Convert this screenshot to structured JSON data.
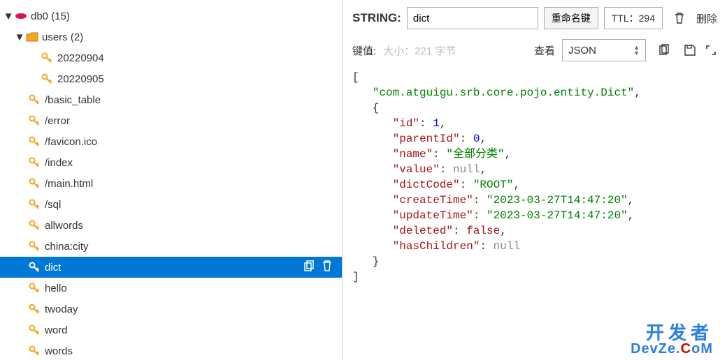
{
  "tree": {
    "db": {
      "label": "db0 (15)"
    },
    "folder_users": {
      "label": "users (2)"
    },
    "keys_users": [
      {
        "label": "20220904"
      },
      {
        "label": "20220905"
      }
    ],
    "keys_top": [
      {
        "label": "/basic_table"
      },
      {
        "label": "/error"
      },
      {
        "label": "/favicon.ico"
      },
      {
        "label": "/index"
      },
      {
        "label": "/main.html"
      },
      {
        "label": "/sql"
      },
      {
        "label": "allwords"
      },
      {
        "label": "china:city"
      },
      {
        "label": "dict",
        "selected": true
      },
      {
        "label": "hello"
      },
      {
        "label": "twoday"
      },
      {
        "label": "word"
      },
      {
        "label": "words"
      }
    ]
  },
  "header": {
    "type_label": "STRING:",
    "key_value": "dict",
    "rename_btn": "重命名键",
    "ttl_label": "TTL：294",
    "delete_btn": "删除"
  },
  "subheader": {
    "value_label": "键值:",
    "size_hint": "大小：221 字节",
    "view_label": "查看",
    "view_mode": "JSON"
  },
  "json_content": {
    "class_name": "com.atguigu.srb.core.pojo.entity.Dict",
    "obj": {
      "id": 1,
      "parentId": 0,
      "name": "全部分类",
      "value": null,
      "dictCode": "ROOT",
      "createTime": "2023-03-27T14:47:20",
      "updateTime": "2023-03-27T14:47:20",
      "deleted": false,
      "hasChildren": null
    }
  },
  "watermark": {
    "line1": "开发者",
    "line2_a": "DevZe.",
    "line2_b": "C",
    "line2_c": "oM"
  }
}
